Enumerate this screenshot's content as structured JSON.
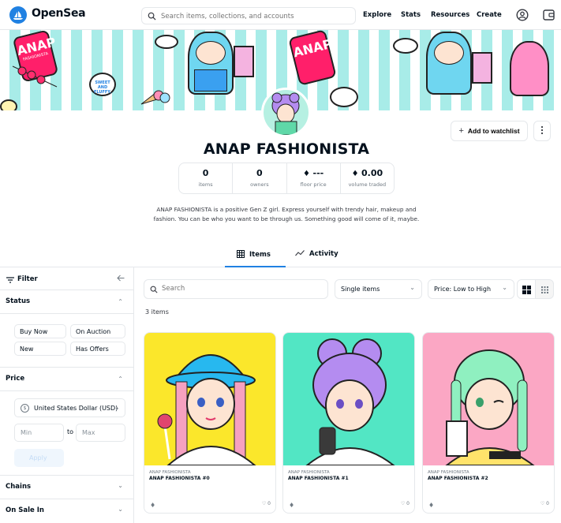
{
  "header": {
    "brand": "OpenSea",
    "search_placeholder": "Search items, collections, and accounts",
    "nav": [
      "Explore",
      "Stats",
      "Resources",
      "Create"
    ]
  },
  "collection": {
    "title": "ANAP FASHIONISTA",
    "watchlist_label": "Add to watchlist",
    "stats": [
      {
        "value": "0",
        "label": "items"
      },
      {
        "value": "0",
        "label": "owners"
      },
      {
        "value": "---",
        "label": "floor price"
      },
      {
        "value": "0.00",
        "label": "volume traded"
      }
    ],
    "description": "ANAP FASHIONISTA is a positive Gen Z girl. Express yourself with trendy hair, makeup and fashion. You can be who you want to be through us. Something good will come of it, maybe."
  },
  "banner_text": {
    "brand_a": "ANAP",
    "brand_b": "FASHIONISTA",
    "bubble": "SWEET AND FLUFFY."
  },
  "tabs": [
    {
      "label": "Items"
    },
    {
      "label": "Activity"
    }
  ],
  "sidebar": {
    "filter_label": "Filter",
    "status": {
      "title": "Status",
      "chips": [
        "Buy Now",
        "On Auction",
        "New",
        "Has Offers"
      ]
    },
    "price": {
      "title": "Price",
      "currency": "United States Dollar (USD)",
      "min_placeholder": "Min",
      "to": "to",
      "max_placeholder": "Max",
      "apply": "Apply"
    },
    "chains": {
      "title": "Chains"
    },
    "on_sale": {
      "title": "On Sale In"
    }
  },
  "main": {
    "search_placeholder": "Search",
    "select_items": "Single items",
    "select_sort": "Price: Low to High",
    "count": "3 items",
    "cards": [
      {
        "collection": "ANAP FASHIONISTA",
        "name": "ANAP FASHIONISTA #0",
        "likes": "0",
        "bg": "#fbe72b"
      },
      {
        "collection": "ANAP FASHIONISTA",
        "name": "ANAP FASHIONISTA #1",
        "likes": "0",
        "bg": "#52e6c4"
      },
      {
        "collection": "ANAP FASHIONISTA",
        "name": "ANAP FASHIONISTA #2",
        "likes": "0",
        "bg": "#fba7c4"
      }
    ]
  },
  "colors": {
    "accent": "#2081e2",
    "banner_stripe": "#a8ece8",
    "text": "#04111d",
    "muted": "#707a83"
  }
}
